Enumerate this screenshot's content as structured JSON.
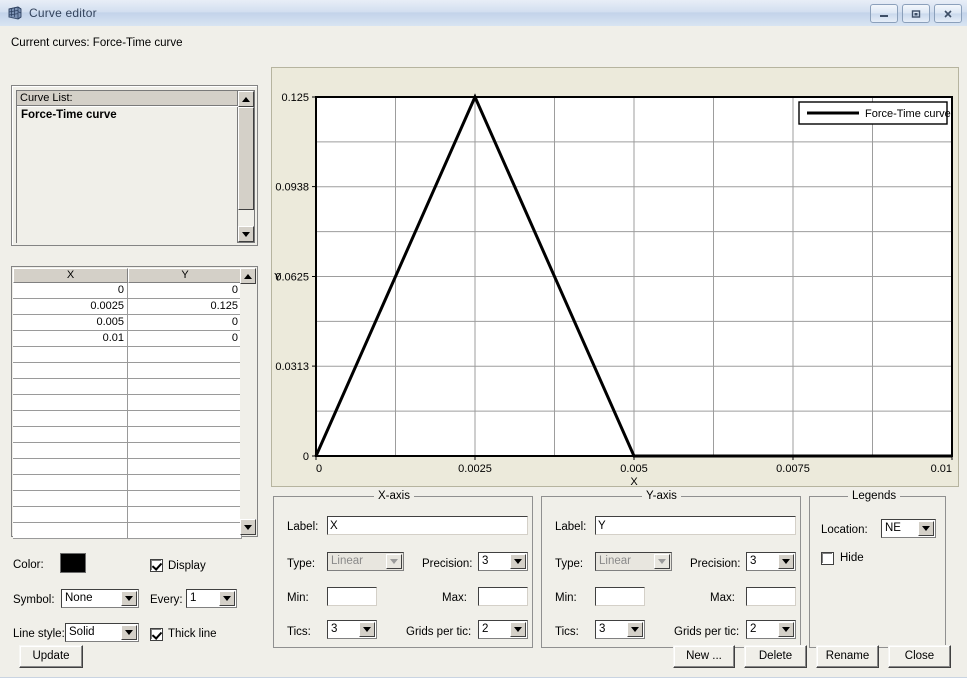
{
  "window": {
    "title": "Curve editor",
    "icon": "grid-icon",
    "buttons": {
      "minimize": "—",
      "maximize": "□",
      "close": "✕"
    }
  },
  "header": {
    "current_curves_label": "Current curves: Force-Time curve"
  },
  "curve_list": {
    "header": "Curve List:",
    "items": [
      "Force-Time curve"
    ]
  },
  "data_table": {
    "columns": [
      "X",
      "Y"
    ],
    "rows": [
      {
        "x": "0",
        "y": "0"
      },
      {
        "x": "0.0025",
        "y": "0.125"
      },
      {
        "x": "0.005",
        "y": "0"
      },
      {
        "x": "0.01",
        "y": "0"
      }
    ],
    "empty_rows": 12
  },
  "style_controls": {
    "color_label": "Color:",
    "color_value": "#000000",
    "display_label": "Display",
    "display_checked": true,
    "symbol_label": "Symbol:",
    "symbol_value": "None",
    "every_label": "Every:",
    "every_value": "1",
    "line_style_label": "Line style:",
    "line_style_value": "Solid",
    "thick_line_label": "Thick line",
    "thick_line_checked": true
  },
  "x_axis": {
    "title": "X-axis",
    "label_label": "Label:",
    "label_value": "X",
    "type_label": "Type:",
    "type_value": "Linear",
    "precision_label": "Precision:",
    "precision_value": "3",
    "min_label": "Min:",
    "min_value": "",
    "max_label": "Max:",
    "max_value": "",
    "tics_label": "Tics:",
    "tics_value": "3",
    "grids_label": "Grids per tic:",
    "grids_value": "2"
  },
  "y_axis": {
    "title": "Y-axis",
    "label_label": "Label:",
    "label_value": "Y",
    "type_label": "Type:",
    "type_value": "Linear",
    "precision_label": "Precision:",
    "precision_value": "3",
    "min_label": "Min:",
    "min_value": "",
    "max_label": "Max:",
    "max_value": "",
    "tics_label": "Tics:",
    "tics_value": "3",
    "grids_label": "Grids per tic:",
    "grids_value": "2"
  },
  "legends": {
    "title": "Legends",
    "location_label": "Location:",
    "location_value": "NE",
    "hide_label": "Hide",
    "hide_checked": false
  },
  "footer": {
    "update": "Update",
    "new": "New ...",
    "delete": "Delete",
    "rename": "Rename",
    "close": "Close"
  },
  "chart_data": {
    "type": "line",
    "title": "",
    "xlabel": "X",
    "ylabel": "Y",
    "xlim": [
      0,
      0.01
    ],
    "ylim": [
      0,
      0.125
    ],
    "xticks": [
      "0",
      "0.0025",
      "0.005",
      "0.0075",
      "0.01"
    ],
    "xtick_values": [
      0,
      0.0025,
      0.005,
      0.0075,
      0.01
    ],
    "yticks": [
      "0",
      "0.0313",
      "0.0625",
      "0.0938",
      "0.125"
    ],
    "ytick_values": [
      0,
      0.0313,
      0.0625,
      0.0938,
      0.125
    ],
    "grid": true,
    "grids_per_tic": 2,
    "legend_position": "NE",
    "series": [
      {
        "name": "Force-Time curve",
        "color": "#000000",
        "width": 3,
        "x": [
          0,
          0.0025,
          0.005,
          0.01
        ],
        "y": [
          0,
          0.125,
          0,
          0
        ]
      }
    ]
  }
}
